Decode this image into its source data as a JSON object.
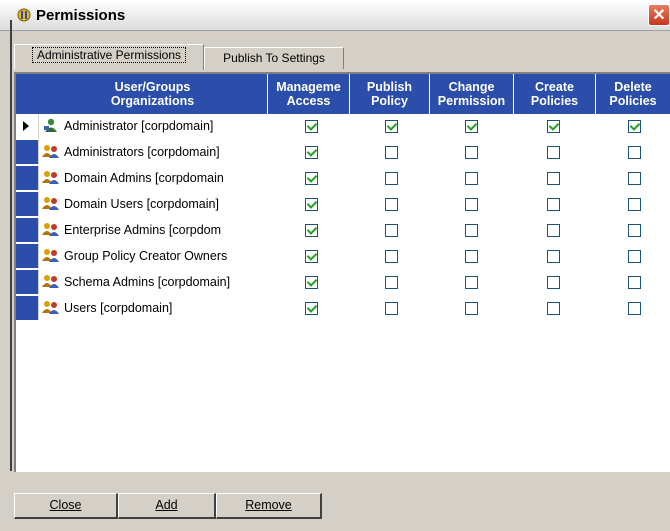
{
  "window": {
    "title": "Permissions",
    "close_glyph": "✕"
  },
  "tabs": [
    {
      "label": "Administrative Permissions",
      "active": true
    },
    {
      "label": "Publish To Settings",
      "active": false
    }
  ],
  "grid": {
    "columns": [
      {
        "label": "User/Groups\nOrganizations"
      },
      {
        "label": "Manageme\nAccess"
      },
      {
        "label": "Publish\nPolicy"
      },
      {
        "label": "Change\nPermission"
      },
      {
        "label": "Create\nPolicies"
      },
      {
        "label": "Delete\nPolicies"
      }
    ],
    "rows": [
      {
        "name": "Administrator [corpdomain]",
        "icon": "user-icon",
        "checks": [
          true,
          true,
          true,
          true,
          true
        ]
      },
      {
        "name": "Administrators  [corpdomain]",
        "icon": "group-icon",
        "checks": [
          true,
          false,
          false,
          false,
          false
        ]
      },
      {
        "name": "Domain Admins [corpdomain",
        "icon": "group-icon",
        "checks": [
          true,
          false,
          false,
          false,
          false
        ]
      },
      {
        "name": "Domain Users [corpdomain]",
        "icon": "group-icon",
        "checks": [
          true,
          false,
          false,
          false,
          false
        ]
      },
      {
        "name": "Enterprise Admins [corpdom",
        "icon": "group-icon",
        "checks": [
          true,
          false,
          false,
          false,
          false
        ]
      },
      {
        "name": "Group Policy Creator Owners",
        "icon": "group-icon",
        "checks": [
          true,
          false,
          false,
          false,
          false
        ]
      },
      {
        "name": "Schema Admins [corpdomain]",
        "icon": "group-icon",
        "checks": [
          true,
          false,
          false,
          false,
          false
        ]
      },
      {
        "name": "Users [corpdomain]",
        "icon": "group-icon",
        "checks": [
          true,
          false,
          false,
          false,
          false
        ]
      }
    ]
  },
  "buttons": {
    "close": "Close",
    "add": "Add",
    "remove": "Remove"
  },
  "colors": {
    "header": "#2b4eaa",
    "check": "#21a121"
  }
}
